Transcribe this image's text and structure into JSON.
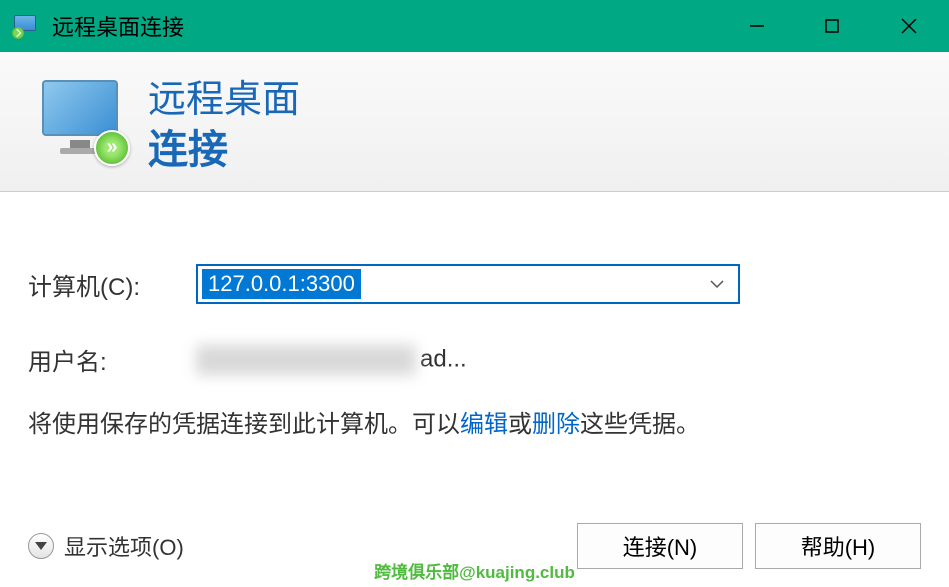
{
  "titlebar": {
    "title": "远程桌面连接"
  },
  "header": {
    "line1": "远程桌面",
    "line2": "连接"
  },
  "form": {
    "computer_label": "计算机(C):",
    "computer_value": "127.0.0.1:3300",
    "username_label": "用户名:",
    "username_visible_suffix": "ad..."
  },
  "description": {
    "text1": "将使用保存的凭据连接到此计算机。可以",
    "edit_link": "编辑",
    "text2": "或",
    "delete_link": "删除",
    "text3": "这些凭据。"
  },
  "footer": {
    "show_options": "显示选项(O)",
    "connect": "连接(N)",
    "help": "帮助(H)"
  },
  "watermark": "跨境俱乐部@kuajing.club"
}
